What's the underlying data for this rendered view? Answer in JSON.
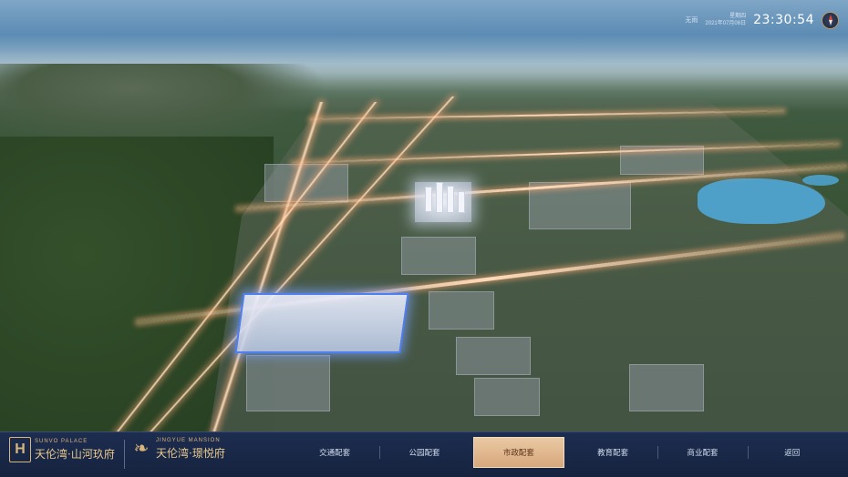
{
  "header": {
    "weather": "无雨",
    "weekday": "星期四",
    "date": "2021年07月08日",
    "time": "23:30:54"
  },
  "brand": {
    "logo1_en": "SUNVO PALACE",
    "logo1_cn": "天伦湾·山河玖府",
    "logo2_en": "JINGYUE MANSION",
    "logo2_cn": "天伦湾·璟悦府"
  },
  "nav": {
    "items": [
      {
        "label": "交通配套"
      },
      {
        "label": "公园配套"
      },
      {
        "label": "市政配套"
      },
      {
        "label": "教育配套"
      },
      {
        "label": "商业配套"
      },
      {
        "label": "返回"
      }
    ],
    "active_index": 2
  },
  "colors": {
    "accent": "#d8b57a",
    "active_tab": "#e3bb92",
    "bar_bg": "#1a2847",
    "highlight_outline": "#4f7ff0"
  }
}
